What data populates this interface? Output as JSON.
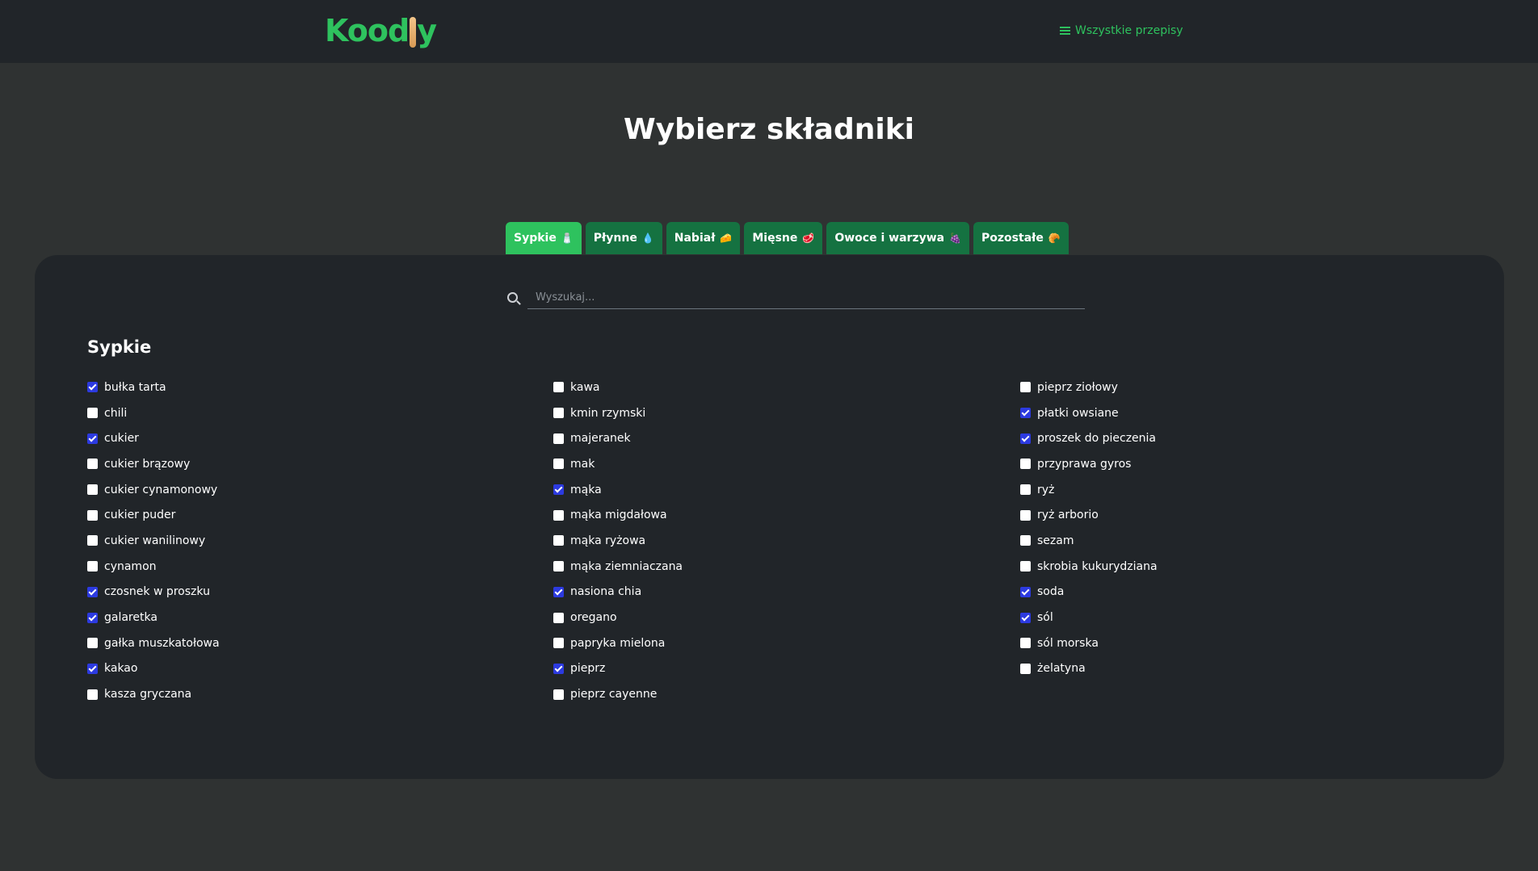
{
  "brand": {
    "name_start": "Kood",
    "name_end": "y",
    "color": "#2ec25e"
  },
  "nav": {
    "all_recipes_label": "Wszystkie przepisy"
  },
  "page": {
    "title": "Wybierz składniki"
  },
  "tabs": [
    {
      "label": "Sypkie",
      "icon": "salt-shaker-icon",
      "glyph": "🧂",
      "active": true
    },
    {
      "label": "Płynne",
      "icon": "water-drop-icon",
      "glyph": "💧",
      "active": false
    },
    {
      "label": "Nabiał",
      "icon": "cheese-icon",
      "glyph": "🧀",
      "active": false
    },
    {
      "label": "Mięsne",
      "icon": "meat-icon",
      "glyph": "🥩",
      "active": false
    },
    {
      "label": "Owoce i warzywa",
      "icon": "grapes-icon",
      "glyph": "🍇",
      "active": false
    },
    {
      "label": "Pozostałe",
      "icon": "croissant-icon",
      "glyph": "🥐",
      "active": false
    }
  ],
  "search": {
    "placeholder": "Wyszukaj..."
  },
  "section": {
    "title": "Sypkie"
  },
  "columns": [
    [
      {
        "label": "bułka tarta",
        "checked": true
      },
      {
        "label": "chili",
        "checked": false
      },
      {
        "label": "cukier",
        "checked": true
      },
      {
        "label": "cukier brązowy",
        "checked": false
      },
      {
        "label": "cukier cynamonowy",
        "checked": false
      },
      {
        "label": "cukier puder",
        "checked": false
      },
      {
        "label": "cukier wanilinowy",
        "checked": false
      },
      {
        "label": "cynamon",
        "checked": false
      },
      {
        "label": "czosnek w proszku",
        "checked": true
      },
      {
        "label": "galaretka",
        "checked": true
      },
      {
        "label": "gałka muszkatołowa",
        "checked": false
      },
      {
        "label": "kakao",
        "checked": true
      },
      {
        "label": "kasza gryczana",
        "checked": false
      }
    ],
    [
      {
        "label": "kawa",
        "checked": false
      },
      {
        "label": "kmin rzymski",
        "checked": false
      },
      {
        "label": "majeranek",
        "checked": false
      },
      {
        "label": "mak",
        "checked": false
      },
      {
        "label": "mąka",
        "checked": true
      },
      {
        "label": "mąka migdałowa",
        "checked": false
      },
      {
        "label": "mąka ryżowa",
        "checked": false
      },
      {
        "label": "mąka ziemniaczana",
        "checked": false
      },
      {
        "label": "nasiona chia",
        "checked": true
      },
      {
        "label": "oregano",
        "checked": false
      },
      {
        "label": "papryka mielona",
        "checked": false
      },
      {
        "label": "pieprz",
        "checked": true
      },
      {
        "label": "pieprz cayenne",
        "checked": false
      }
    ],
    [
      {
        "label": "pieprz ziołowy",
        "checked": false
      },
      {
        "label": "płatki owsiane",
        "checked": true
      },
      {
        "label": "proszek do pieczenia",
        "checked": true
      },
      {
        "label": "przyprawa gyros",
        "checked": false
      },
      {
        "label": "ryż",
        "checked": false
      },
      {
        "label": "ryż arborio",
        "checked": false
      },
      {
        "label": "sezam",
        "checked": false
      },
      {
        "label": "skrobia kukurydziana",
        "checked": false
      },
      {
        "label": "soda",
        "checked": true
      },
      {
        "label": "sól",
        "checked": true
      },
      {
        "label": "sól morska",
        "checked": false
      },
      {
        "label": "żelatyna",
        "checked": false
      }
    ]
  ]
}
